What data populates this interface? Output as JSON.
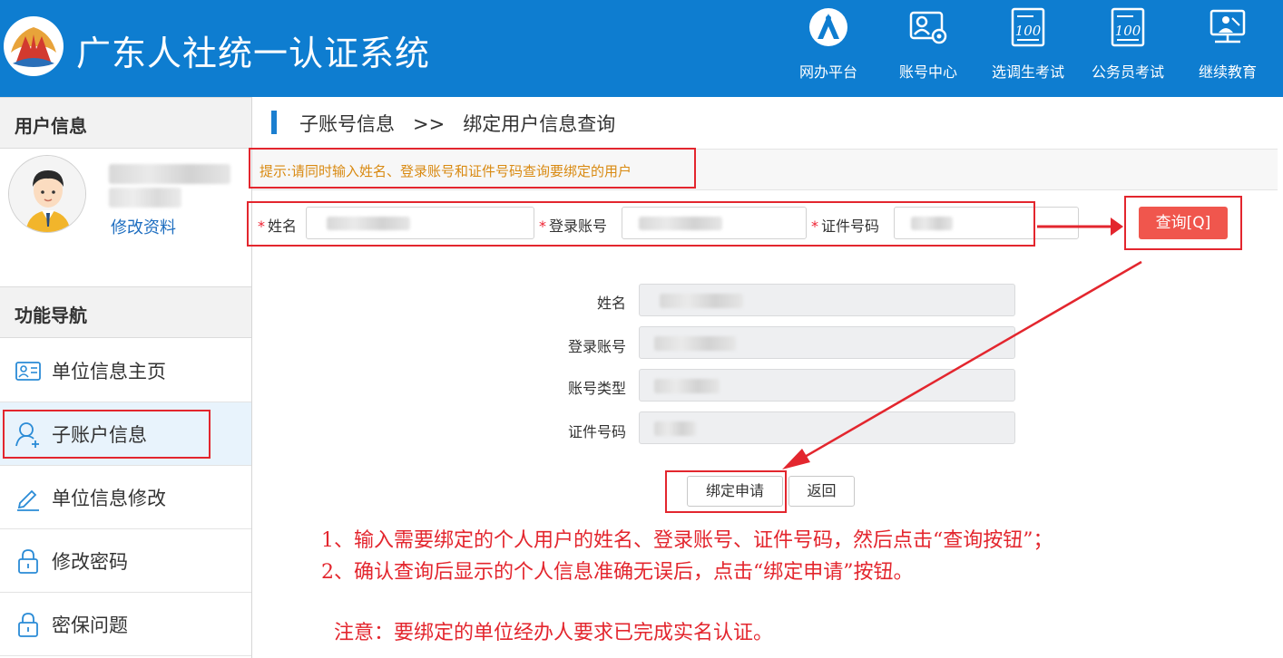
{
  "header": {
    "title": "广东人社统一认证系统",
    "logo_icon": "gdhrss-logo-icon",
    "nav": [
      {
        "label": "网办平台",
        "icon": "online-office-icon"
      },
      {
        "label": "账号中心",
        "icon": "account-center-icon"
      },
      {
        "label": "选调生考试",
        "icon": "exam-100-icon"
      },
      {
        "label": "公务员考试",
        "icon": "exam-100-icon"
      },
      {
        "label": "继续教育",
        "icon": "continuing-education-icon"
      }
    ]
  },
  "sidebar": {
    "user_section_title": "用户信息",
    "edit_profile": "修改资料",
    "nav_section_title": "功能导航",
    "items": [
      {
        "label": "单位信息主页",
        "icon": "id-card-icon"
      },
      {
        "label": "子账户信息",
        "icon": "user-add-icon",
        "active": true
      },
      {
        "label": "单位信息修改",
        "icon": "pencil-icon"
      },
      {
        "label": "修改密码",
        "icon": "lock-icon"
      },
      {
        "label": "密保问题",
        "icon": "lock-icon"
      }
    ]
  },
  "main": {
    "breadcrumb": "子账号信息   >>   绑定用户信息查询",
    "tip": "提示:请同时输入姓名、登录账号和证件号码查询要绑定的用户",
    "search": {
      "required_mark": "*",
      "name_label": "姓名",
      "account_label": "登录账号",
      "id_label": "证件号码",
      "query_button": "查询[Q]"
    },
    "result": {
      "name_label": "姓名",
      "account_label": "登录账号",
      "type_label": "账号类型",
      "id_label": "证件号码"
    },
    "bind_button": "绑定申请",
    "back_button": "返回"
  },
  "notes": {
    "line1": "1、输入需要绑定的个人用户的姓名、登录账号、证件号码，然后点击“查询按钮”；",
    "line2": "2、确认查询后显示的个人信息准确无误后，点击“绑定申请”按钮。",
    "line3": "注意：要绑定的单位经办人要求已完成实名认证。"
  },
  "colors": {
    "header_bg": "#0e7dd0",
    "annotation_red": "#e3262e",
    "query_button": "#f0564d",
    "tip_text": "#d98a12"
  }
}
